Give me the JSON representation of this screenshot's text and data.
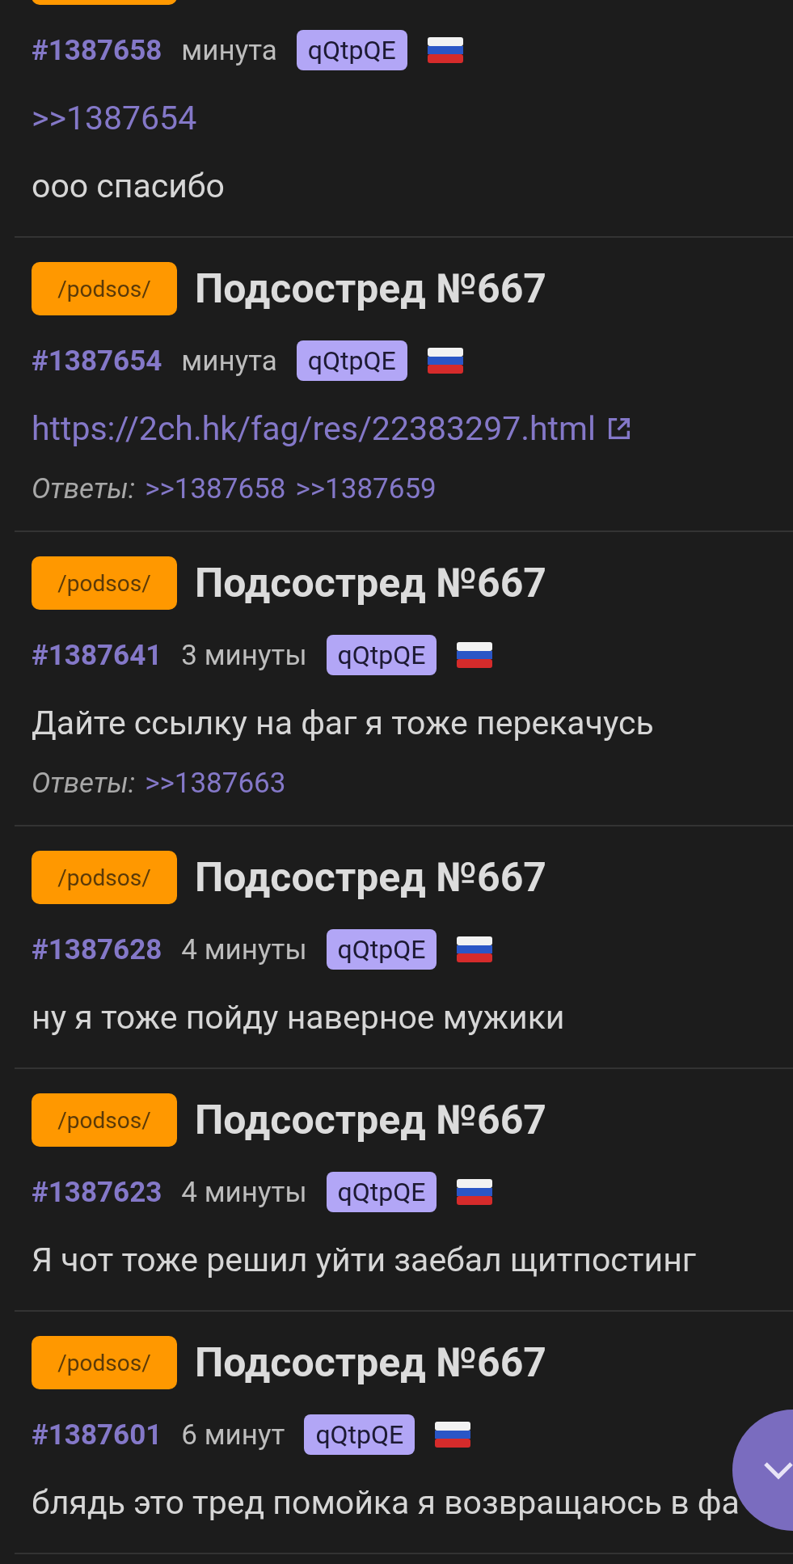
{
  "posts": [
    {
      "kind": "partial",
      "number": "#1387658",
      "time": "минута",
      "id_tag": "qQtpQE",
      "content": [
        {
          "kind": "reply_link",
          "text": ">>1387654"
        },
        {
          "kind": "text",
          "text": "ооо спасибо"
        }
      ]
    },
    {
      "kind": "full",
      "board": "/podsos/",
      "title": "Подсостред №667",
      "number": "#1387654",
      "time": "минута",
      "id_tag": "qQtpQE",
      "content": [
        {
          "kind": "url",
          "text": "https://2ch.hk/fag/res/22383297.html"
        }
      ],
      "replies_label": "Ответы:",
      "replies": [
        ">>1387658",
        ">>1387659"
      ]
    },
    {
      "kind": "full",
      "board": "/podsos/",
      "title": "Подсостред №667",
      "number": "#1387641",
      "time": "3 минуты",
      "id_tag": "qQtpQE",
      "content": [
        {
          "kind": "text",
          "text": "Дайте ссылку на фаг я тоже перекачусь"
        }
      ],
      "replies_label": "Ответы:",
      "replies": [
        ">>1387663"
      ]
    },
    {
      "kind": "full",
      "board": "/podsos/",
      "title": "Подсостред №667",
      "number": "#1387628",
      "time": "4 минуты",
      "id_tag": "qQtpQE",
      "content": [
        {
          "kind": "text",
          "text": "ну я тоже пойду наверное мужики"
        }
      ]
    },
    {
      "kind": "full",
      "board": "/podsos/",
      "title": "Подсостред №667",
      "number": "#1387623",
      "time": "4 минуты",
      "id_tag": "qQtpQE",
      "content": [
        {
          "kind": "text",
          "text": "Я чот тоже решил уйти заебал щитпостинг"
        }
      ]
    },
    {
      "kind": "full",
      "board": "/podsos/",
      "title": "Подсостред №667",
      "number": "#1387601",
      "time": "6 минут",
      "id_tag": "qQtpQE",
      "content": [
        {
          "kind": "text",
          "text": "блядь это тред помойка я возвращаюсь в фа"
        }
      ]
    }
  ]
}
